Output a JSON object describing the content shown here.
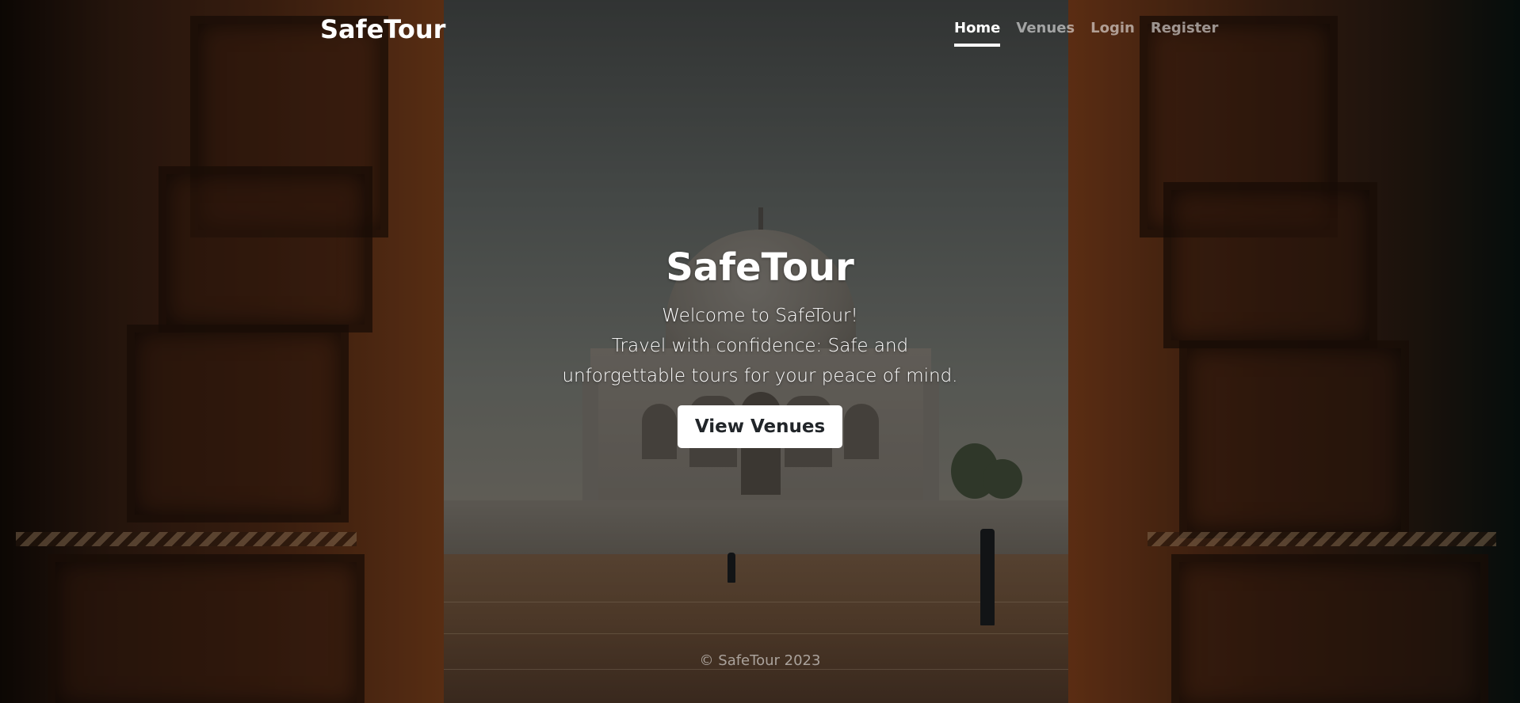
{
  "brand": "SafeTour",
  "nav": {
    "items": [
      {
        "label": "Home",
        "active": true
      },
      {
        "label": "Venues",
        "active": false
      },
      {
        "label": "Login",
        "active": false
      },
      {
        "label": "Register",
        "active": false
      }
    ]
  },
  "hero": {
    "title": "SafeTour",
    "welcome": "Welcome to SafeTour!",
    "tagline": "Travel with confidence: Safe and unforgettable tours for your peace of mind.",
    "button_label": "View Venues"
  },
  "footer": {
    "text": "© SafeTour 2023"
  },
  "colors": {
    "button_bg": "#ffffff",
    "button_text": "#212529",
    "nav_inactive": "rgba(255,255,255,0.55)"
  },
  "background": {
    "description_icon": "taj-mahal-through-arched-doorway-photo"
  }
}
